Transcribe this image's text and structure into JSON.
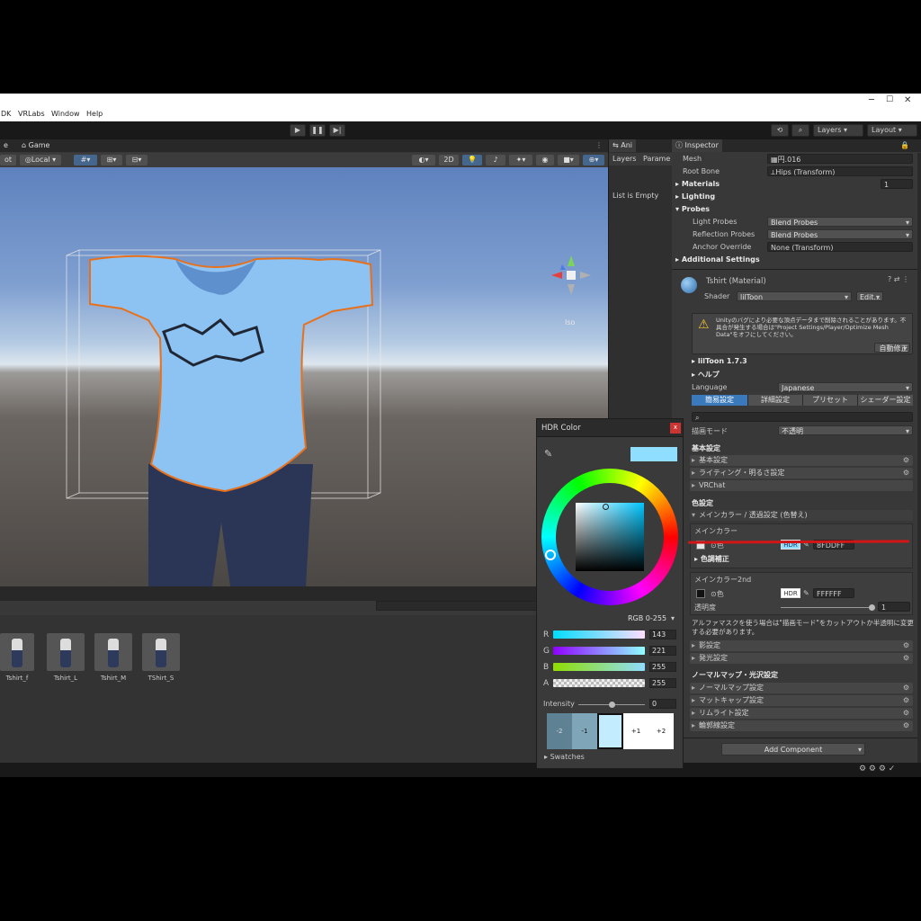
{
  "menu": {
    "items": [
      "DK",
      "VRLabs",
      "Window",
      "Help"
    ]
  },
  "toolbar": {
    "layers": "Layers",
    "layout": "Layout"
  },
  "scene_tabs": {
    "scene": "e",
    "game": "Game"
  },
  "scene_toolbar": {
    "pivot": "ot",
    "local": "Local",
    "mode_2d": "2D"
  },
  "gizmo": {
    "label": "Iso"
  },
  "animator": {
    "tab": "Ani",
    "layers": "Layers",
    "params": "Parame",
    "empty": "List is Empty"
  },
  "project": {
    "items": [
      {
        "label": "Tshirt_f"
      },
      {
        "label": "Tshirt_L"
      },
      {
        "label": "Tshirt_M"
      },
      {
        "label": "TShirt_S"
      }
    ]
  },
  "inspector": {
    "tab": "Inspector",
    "mesh_label": "Mesh",
    "mesh_value": "円.016",
    "root_bone_label": "Root Bone",
    "root_bone_value": "Hips (Transform)",
    "materials_label": "Materials",
    "materials_count": "1",
    "lighting_label": "Lighting",
    "probes_label": "Probes",
    "light_probes_label": "Light Probes",
    "light_probes_value": "Blend Probes",
    "reflection_probes_label": "Reflection Probes",
    "reflection_probes_value": "Blend Probes",
    "anchor_label": "Anchor Override",
    "anchor_value": "None (Transform)",
    "additional_label": "Additional Settings",
    "material_name": "Tshirt (Material)",
    "shader_label": "Shader",
    "shader_value": "lilToon",
    "edit_label": "Edit...",
    "warning_text": "Unityのバグにより必要な頂点データまで削除されることがあります。不具合が発生する場合は\"Project Settings/Player/Optimize Mesh Data\"をオフにしてください。",
    "autofix_label": "自動修正",
    "liltoon_version": "lilToon 1.7.3",
    "help_label": "ヘルプ",
    "language_label": "Language",
    "language_value": "Japanese",
    "mode_tabs": [
      "簡易設定",
      "詳細設定",
      "プリセット",
      "シェーダー設定"
    ],
    "render_mode_label": "描画モード",
    "render_mode_value": "不透明",
    "basic_header": "基本設定",
    "basic_sections": [
      "基本設定",
      "ライティング・明るさ設定",
      "VRChat"
    ],
    "color_header": "色設定",
    "main_color_section": "メインカラー / 透過設定 (色替え)",
    "main_color_title": "メインカラー",
    "color_label": "色",
    "hdr_label": "HDR",
    "main_hex": "8FDDFF",
    "color_correction_label": "色調補正",
    "main2_title": "メインカラー2nd",
    "main2_hex": "FFFFFF",
    "opacity_label": "透明度",
    "opacity_value": "1",
    "alpha_note": "アルファマスクを使う場合は\"描画モード\"をカットアウトか半透明に変更する必要があります。",
    "other_sections": [
      "影設定",
      "発光設定"
    ],
    "normal_header": "ノーマルマップ・光沢設定",
    "normal_sections": [
      "ノーマルマップ設定",
      "マットキャップ設定",
      "リムライト設定",
      "輪郭線設定"
    ],
    "add_component": "Add Component"
  },
  "hdr_color": {
    "title": "HDR Color",
    "close": "x",
    "mode": "RGB 0-255",
    "channels": [
      {
        "label": "R",
        "value": "143"
      },
      {
        "label": "G",
        "value": "221"
      },
      {
        "label": "B",
        "value": "255"
      },
      {
        "label": "A",
        "value": "255"
      }
    ],
    "intensity_label": "Intensity",
    "intensity_value": "0",
    "swatch_steps": [
      "-2",
      "-1",
      "",
      "+1",
      "+2"
    ],
    "swatches_label": "Swatches",
    "current_color": "#8FDDFF"
  },
  "colors": {
    "accent_blue": "#3a79bb",
    "selection_outline": "#e8701a",
    "annotation_red": "#d41515"
  }
}
